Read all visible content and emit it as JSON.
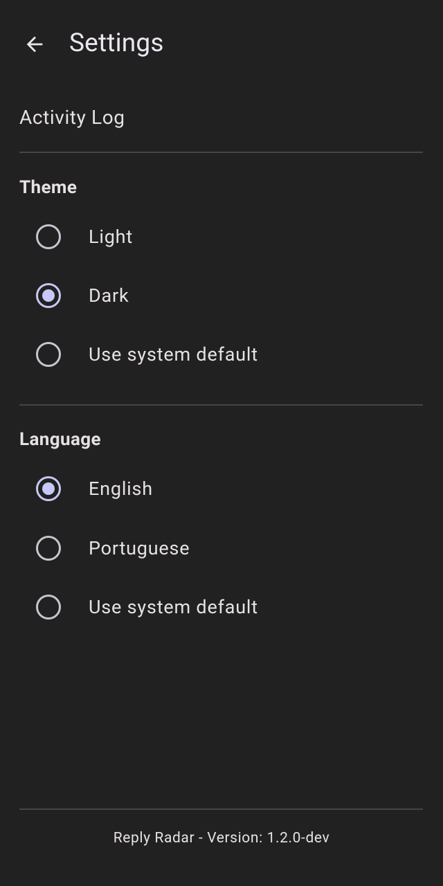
{
  "app_bar": {
    "title": "Settings",
    "back_icon": "arrow-back-icon"
  },
  "activity_log": {
    "label": "Activity Log"
  },
  "theme": {
    "title": "Theme",
    "options": [
      {
        "label": "Light",
        "selected": false
      },
      {
        "label": "Dark",
        "selected": true
      },
      {
        "label": "Use system default",
        "selected": false
      }
    ]
  },
  "language": {
    "title": "Language",
    "options": [
      {
        "label": "English",
        "selected": true
      },
      {
        "label": "Portuguese",
        "selected": false
      },
      {
        "label": "Use system default",
        "selected": false
      }
    ]
  },
  "footer": {
    "version_text": "Reply Radar - Version: 1.2.0-dev"
  },
  "colors": {
    "background": "#212121",
    "accent": "#C7C8F7",
    "divider": "#46444C"
  }
}
